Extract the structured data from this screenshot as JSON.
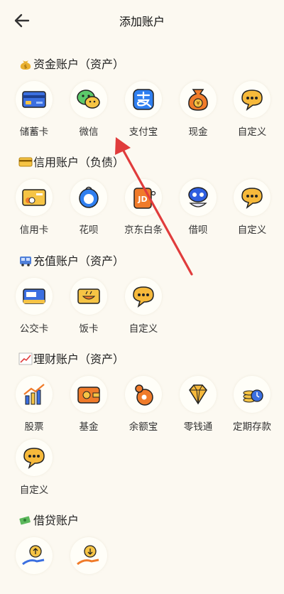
{
  "header": {
    "title": "添加账户",
    "back_icon": "arrow-left-icon"
  },
  "sections": [
    {
      "title": "资金账户（资产）",
      "emoji": "money-bag-icon",
      "items": [
        {
          "label": "储蓄卡",
          "icon": "bank-card-icon"
        },
        {
          "label": "微信",
          "icon": "wechat-icon"
        },
        {
          "label": "支付宝",
          "icon": "alipay-icon"
        },
        {
          "label": "现金",
          "icon": "cash-bag-icon"
        },
        {
          "label": "自定义",
          "icon": "custom-bubble-icon"
        }
      ]
    },
    {
      "title": "信用账户（负债）",
      "emoji": "credit-card-emoji-icon",
      "items": [
        {
          "label": "信用卡",
          "icon": "credit-card-icon"
        },
        {
          "label": "花呗",
          "icon": "huabei-icon"
        },
        {
          "label": "京东白条",
          "icon": "jd-baitiao-icon"
        },
        {
          "label": "借呗",
          "icon": "jiebei-icon"
        },
        {
          "label": "自定义",
          "icon": "custom-bubble-icon"
        }
      ]
    },
    {
      "title": "充值账户（资产）",
      "emoji": "bus-emoji-icon",
      "items": [
        {
          "label": "公交卡",
          "icon": "bus-card-icon"
        },
        {
          "label": "饭卡",
          "icon": "meal-card-icon"
        },
        {
          "label": "自定义",
          "icon": "custom-bubble-icon"
        }
      ]
    },
    {
      "title": "理财账户（资产）",
      "emoji": "chart-up-emoji-icon",
      "items": [
        {
          "label": "股票",
          "icon": "stock-chart-icon"
        },
        {
          "label": "基金",
          "icon": "fund-wallet-icon"
        },
        {
          "label": "余额宝",
          "icon": "yuebao-icon"
        },
        {
          "label": "零钱通",
          "icon": "diamond-icon"
        },
        {
          "label": "定期存款",
          "icon": "time-deposit-icon"
        },
        {
          "label": "自定义",
          "icon": "custom-bubble-icon"
        }
      ]
    },
    {
      "title": "借贷账户",
      "emoji": "flying-money-emoji-icon",
      "items": [
        {
          "label": "",
          "icon": "lend-out-icon"
        },
        {
          "label": "",
          "icon": "borrow-in-icon"
        }
      ]
    }
  ],
  "colors": {
    "background": "#fcf9f1",
    "accent_yellow": "#f6b93b",
    "annotation_arrow": "#e03c3c"
  }
}
